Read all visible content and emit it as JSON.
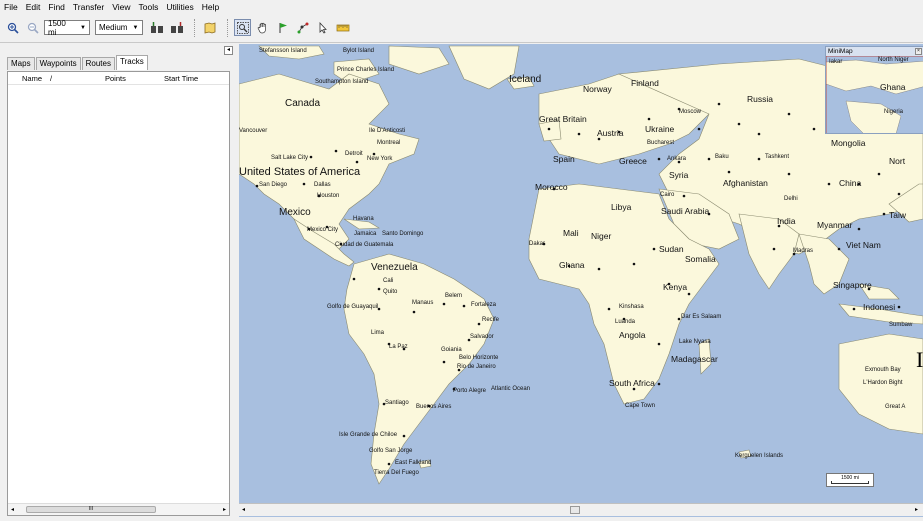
{
  "menu": {
    "items": [
      "File",
      "Edit",
      "Find",
      "Transfer",
      "View",
      "Tools",
      "Utilities",
      "Help"
    ]
  },
  "toolbar": {
    "zoom_value": "1500 mi",
    "detail_value": "Medium",
    "icons": [
      "zoom-in-icon",
      "zoom-out-icon",
      "receive-icon",
      "send-icon",
      "map-icon",
      "zoom-tool-icon",
      "hand-tool-icon",
      "waypoint-flag-icon",
      "route-tool-icon",
      "select-tool-icon",
      "ruler-tool-icon"
    ]
  },
  "left_panel": {
    "close_label": "◂",
    "tabs": [
      "Maps",
      "Waypoints",
      "Routes",
      "Tracks"
    ],
    "selected_tab": "Tracks",
    "columns": {
      "name": "Name",
      "sort": "/",
      "points": "Points",
      "start_time": "Start Time"
    },
    "scroll_thumb": "III"
  },
  "map": {
    "ocean_color": "#a8bfdf",
    "land_color": "#fbf8dc",
    "labels": {
      "iceland": "Iceland",
      "canada": "Canada",
      "norway": "Norway",
      "finland": "Finland",
      "russia": "Russia",
      "great_britain": "Great Britain",
      "austria": "Austria",
      "ukraine": "Ukraine",
      "mongolia": "Mongolia",
      "spain": "Spain",
      "greece": "Greece",
      "syria": "Syria",
      "afghanistan": "Afghanistan",
      "china": "China",
      "north": "Nort",
      "usa": "United States of America",
      "morocco": "Morocco",
      "libya": "Libya",
      "saudi_arabia": "Saudi Arabia",
      "india": "India",
      "myanmar": "Myanmar",
      "taiwan": "Taiw",
      "mexico": "Mexico",
      "mali": "Mali",
      "niger": "Niger",
      "sudan": "Sudan",
      "viet_nam": "Viet Nam",
      "ghana": "Ghana",
      "somalia": "Somalia",
      "venezuela": "Venezuela",
      "kenya": "Kenya",
      "singapore": "Singapore",
      "indonesia": "Indonesi",
      "angola": "Angola",
      "madagascar": "Madagascar",
      "south_africa": "South Africa"
    },
    "cities": {
      "stefansson": "Stefansson Island",
      "bylot": "Bylot Island",
      "prince_charles": "Prince Charles Island",
      "southampton": "Southampton Island",
      "moscow": "Moscow",
      "vancouver": "Vancouver",
      "anticosti": "Ile D'Anticosti",
      "montreal": "Montreal",
      "bucharest": "Bucharest",
      "salt_lake": "Salt Lake City",
      "detroit": "Detroit",
      "new_york": "New York",
      "ankara": "Ankara",
      "baku": "Baku",
      "tashkent": "Tashkent",
      "san_diego": "San Diego",
      "dallas": "Dallas",
      "cairo": "Cairo",
      "houston": "Houston",
      "delhi": "Delhi",
      "havana": "Havana",
      "mexico_city": "Mexico City",
      "jamaica": "Jamaica",
      "santo_domingo": "Santo Domingo",
      "madras": "Madras",
      "guatemala": "Ciudad de Guatemala",
      "dakar": "Dakar",
      "cali": "Cali",
      "quito": "Quito",
      "belem": "Belem",
      "manaus": "Manaus",
      "fortaleza": "Fortaleza",
      "guayaquil": "Golfo de Guayaquil",
      "recife": "Recife",
      "kinshasa": "Kinshasa",
      "dar_es_salaam": "Dar Es Salaam",
      "luanda": "Luanda",
      "sumbawa": "Sumbaw",
      "lima": "Lima",
      "salvador": "Salvador",
      "lake_nyasa": "Lake Nyasa",
      "la_paz": "La Paz",
      "goiania": "Goiania",
      "belo_horizonte": "Belo Horizonte",
      "rio": "Rio de Janeiro",
      "exmouth": "Exmouth Bay",
      "lhardon": "L'Hardon Bight",
      "porto_alegre": "Porto Alegre",
      "atlantic": "Atlantic Ocean",
      "santiago": "Santiago",
      "buenos_aires": "Buenos Aires",
      "cape_town": "Cape Town",
      "great_a": "Great A",
      "chiloe": "Isle Grande de Chiloe",
      "kerguelen": "Kerguelen Islands",
      "san_jorge": "Golfo San Jorge",
      "east_falkland": "East Falkland",
      "tierra": "Tierra Del Fuego"
    },
    "scale_label": "1500 mi",
    "minimap": {
      "title": "MiniMap",
      "labels": {
        "alaska": "Iakar",
        "north": "North Niger",
        "ghana": "Ghana",
        "nigeria": "Nigeria"
      }
    }
  },
  "overflow_char": "I"
}
